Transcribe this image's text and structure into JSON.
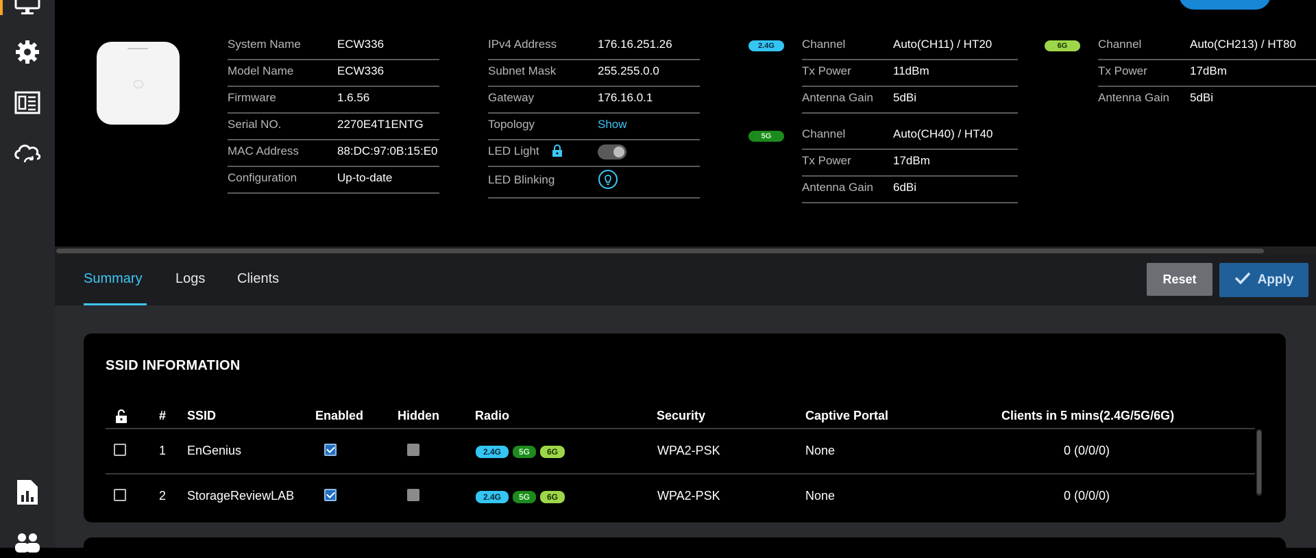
{
  "colors": {
    "accent": "#3ec6f5",
    "band_24": "#34c5f3",
    "band_5": "#1d8a1d",
    "band_6": "#9ed64a",
    "apply": "#1f5f9a",
    "reset": "#6b6e73"
  },
  "sidebar": {
    "items": [
      {
        "icon": "monitor-icon"
      },
      {
        "icon": "gear-icon"
      },
      {
        "icon": "newspaper-icon"
      },
      {
        "icon": "cloud-sync-icon"
      },
      {
        "icon": "report-chart-icon"
      },
      {
        "icon": "users-icon"
      }
    ]
  },
  "device": {
    "col1": [
      {
        "label": "System Name",
        "value": "ECW336"
      },
      {
        "label": "Model Name",
        "value": "ECW336"
      },
      {
        "label": "Firmware",
        "value": "1.6.56"
      },
      {
        "label": "Serial NO.",
        "value": "2270E4T1ENTG"
      },
      {
        "label": "MAC Address",
        "value": "88:DC:97:0B:15:E0"
      },
      {
        "label": "Configuration",
        "value": "Up-to-date"
      }
    ],
    "col2": [
      {
        "label": "IPv4 Address",
        "value": "176.16.251.26"
      },
      {
        "label": "Subnet Mask",
        "value": "255.255.0.0"
      },
      {
        "label": "Gateway",
        "value": "176.16.0.1"
      },
      {
        "label": "Topology",
        "value": "Show"
      },
      {
        "label": "LED Light",
        "value": ""
      },
      {
        "label": "LED Blinking",
        "value": ""
      }
    ],
    "led_light_on": true
  },
  "radios": {
    "band_24": {
      "badge": "2.4G",
      "rows": [
        {
          "label": "Channel",
          "value": "Auto(CH11) / HT20"
        },
        {
          "label": "Tx Power",
          "value": "11dBm"
        },
        {
          "label": "Antenna Gain",
          "value": "5dBi"
        }
      ]
    },
    "band_5": {
      "badge": "5G",
      "rows": [
        {
          "label": "Channel",
          "value": "Auto(CH40) / HT40"
        },
        {
          "label": "Tx Power",
          "value": "17dBm"
        },
        {
          "label": "Antenna Gain",
          "value": "6dBi"
        }
      ]
    },
    "band_6": {
      "badge": "6G",
      "rows": [
        {
          "label": "Channel",
          "value": "Auto(CH213) / HT80"
        },
        {
          "label": "Tx Power",
          "value": "17dBm"
        },
        {
          "label": "Antenna Gain",
          "value": "5dBi"
        }
      ]
    }
  },
  "tabs": [
    {
      "label": "Summary",
      "active": true
    },
    {
      "label": "Logs",
      "active": false
    },
    {
      "label": "Clients",
      "active": false
    }
  ],
  "actions": {
    "reset_label": "Reset",
    "apply_label": "Apply"
  },
  "ssid_table": {
    "title": "SSID INFORMATION",
    "columns": [
      "#",
      "SSID",
      "Enabled",
      "Hidden",
      "Radio",
      "Security",
      "Captive Portal",
      "Clients in 5 mins(2.4G/5G/6G)"
    ],
    "rows": [
      {
        "num": "1",
        "ssid": "EnGenius",
        "enabled": true,
        "hidden": false,
        "radios": [
          "2.4G",
          "5G",
          "6G"
        ],
        "security": "WPA2-PSK",
        "captive_portal": "None",
        "clients": "0 (0/0/0)"
      },
      {
        "num": "2",
        "ssid": "StorageReviewLAB",
        "enabled": true,
        "hidden": false,
        "radios": [
          "2.4G",
          "5G",
          "6G"
        ],
        "security": "WPA2-PSK",
        "captive_portal": "None",
        "clients": "0 (0/0/0)"
      }
    ]
  }
}
